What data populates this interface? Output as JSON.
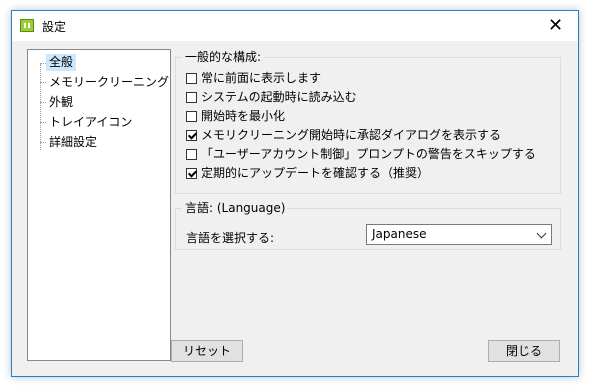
{
  "window": {
    "title": "設定",
    "close_glyph": "✕"
  },
  "tree": {
    "items": [
      {
        "label": "全般",
        "selected": true
      },
      {
        "label": "メモリークリーニング",
        "selected": false
      },
      {
        "label": "外観",
        "selected": false
      },
      {
        "label": "トレイアイコン",
        "selected": false
      },
      {
        "label": "詳細設定",
        "selected": false
      }
    ]
  },
  "general": {
    "title": "一般的な構成:",
    "options": [
      {
        "label": "常に前面に表示します",
        "checked": false
      },
      {
        "label": "システムの起動時に読み込む",
        "checked": false
      },
      {
        "label": "開始時を最小化",
        "checked": false
      },
      {
        "label": "メモリクリーニング開始時に承認ダイアログを表示する",
        "checked": true
      },
      {
        "label": "「ユーザーアカウント制御」プロンプトの警告をスキップする",
        "checked": false
      },
      {
        "label": "定期的にアップデートを確認する（推奨）",
        "checked": true
      }
    ]
  },
  "language": {
    "title": "言語: (Language)",
    "label": "言語を選択する:",
    "selected": "Japanese"
  },
  "buttons": {
    "reset": "リセット",
    "close": "閉じる"
  },
  "colors": {
    "accent": "#1883d7",
    "selection": "#cce8ff"
  }
}
